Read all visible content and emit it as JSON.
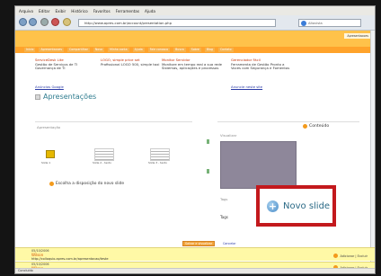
{
  "menu": [
    "Arquivo",
    "Editar",
    "Exibir",
    "Histórico",
    "Favoritos",
    "Ferramentas",
    "Ajuda"
  ],
  "browser": {
    "url": "http://www.apres.com.br/account/presentation.php",
    "search_placeholder": "Altavista"
  },
  "site": {
    "welcome": "Apresentacoes",
    "tabs": [
      "Inicio",
      "Apresentacoes",
      "Compartilhar",
      "Novo",
      "Minha conta",
      "Ajuda",
      "Fale conosco",
      "Busca",
      "Sobre",
      "Blog",
      "Contato"
    ]
  },
  "promos": [
    {
      "title": "ServiceDesk Lite",
      "desc": "Gestão de Serviços de TI Governança de TI"
    },
    {
      "title": "LOGO, simple price set",
      "desc": "Profissional LOGO 500, simple taxi"
    },
    {
      "title": "Monitor Servidor",
      "desc": "Monitore em tempo real a sua rede Sistemas, aplicações e processos"
    },
    {
      "title": "Gerenciador Fácil",
      "desc": "Ferramenta de Gestão Pronto a Voces com Segurança e Fomentos"
    }
  ],
  "links": {
    "left": "Anúncios Google",
    "right": "Anuncie neste site"
  },
  "page_title": "Apresentações",
  "sections": {
    "left": "Apresentação",
    "preview": "Visualizar",
    "tags": "Tags",
    "conteudo": "Conteúdo"
  },
  "thumbs": [
    "Slide 1",
    "Slide 2 - texto",
    "Slide 3 - texto"
  ],
  "help": "Escolha a disposição do novo slide",
  "novo_slide": "Novo slide",
  "tag_text": "Tags",
  "buttons": {
    "save": "Salvar e visualizar",
    "cancel": "Cancelar"
  },
  "comments": [
    {
      "date": "05/10/2006",
      "name": "Wilson",
      "url": "http://colloquio.apres.com.br/apresentacao/teste",
      "actions": "Adicionar | Excluir"
    },
    {
      "date": "05/10/2006",
      "name": "Wilson",
      "url": "",
      "actions": "Adicionar | Excluir"
    }
  ],
  "status": "Concluído"
}
